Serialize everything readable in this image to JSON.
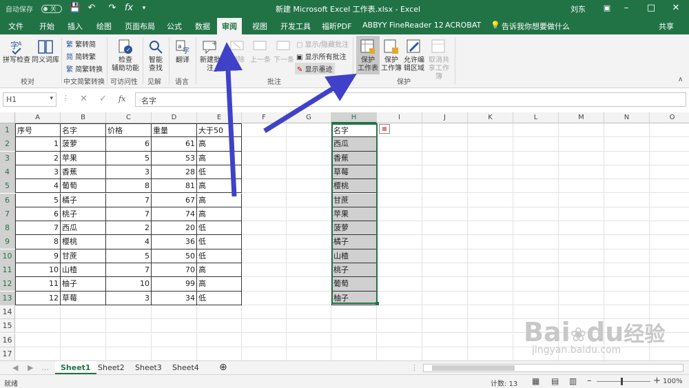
{
  "titlebar": {
    "autosave": "自动保存",
    "autosave_state": "关",
    "title": "新建 Microsoft Excel 工作表.xlsx  -  Excel",
    "user": "刘东"
  },
  "tabs": [
    "文件",
    "开始",
    "插入",
    "绘图",
    "页面布局",
    "公式",
    "数据",
    "审阅",
    "视图",
    "开发工具",
    "福昕PDF",
    "ABBYY FineReader 12",
    "ACROBAT"
  ],
  "tell_me": "告诉我你想要做什么",
  "share": "共享",
  "ribbon": {
    "spell": "拼写检查",
    "thesaurus": "同义词库",
    "group_proof": "校对",
    "trad": "繁转简",
    "simp": "简转繁",
    "convert": "简繁转换",
    "group_chinese": "中文简繁转换",
    "access_check_1": "检查",
    "access_check_2": "辅助功能",
    "group_access": "可访问性",
    "smart_1": "智能",
    "smart_2": "查找",
    "group_insight": "见解",
    "translate": "翻译",
    "group_lang": "语言",
    "new_comment": "新建批注",
    "delete": "删除",
    "prev": "上一条",
    "next": "下一条",
    "show_hide": "显示/隐藏批注",
    "show_all": "显示所有批注",
    "show_ink": "显示墨迹",
    "group_comment": "批注",
    "protect_sheet_1": "保护",
    "protect_sheet_2": "工作表",
    "protect_wb_1": "保护",
    "protect_wb_2": "工作簿",
    "allow_1": "允许编",
    "allow_2": "辑区域",
    "unshare_1": "取消共",
    "unshare_2": "享工作簿",
    "group_protect": "保护"
  },
  "formula_bar": {
    "name_box": "H1",
    "fx": "fx",
    "content": "名字"
  },
  "columns": [
    "A",
    "B",
    "C",
    "D",
    "E",
    "F",
    "G",
    "H",
    "I",
    "J",
    "K",
    "L",
    "M",
    "N",
    "O"
  ],
  "table": {
    "headers": [
      "序号",
      "名字",
      "价格",
      "重量",
      "大于50"
    ],
    "rows": [
      [
        "1",
        "菠萝",
        "6",
        "61",
        "高"
      ],
      [
        "2",
        "苹果",
        "5",
        "53",
        "高"
      ],
      [
        "3",
        "香蕉",
        "3",
        "28",
        "低"
      ],
      [
        "4",
        "葡萄",
        "8",
        "81",
        "高"
      ],
      [
        "5",
        "橘子",
        "7",
        "67",
        "高"
      ],
      [
        "6",
        "桃子",
        "7",
        "74",
        "高"
      ],
      [
        "7",
        "西瓜",
        "2",
        "20",
        "低"
      ],
      [
        "8",
        "樱桃",
        "4",
        "36",
        "低"
      ],
      [
        "9",
        "甘蔗",
        "5",
        "50",
        "低"
      ],
      [
        "10",
        "山楂",
        "7",
        "70",
        "高"
      ],
      [
        "11",
        "柚子",
        "10",
        "99",
        "高"
      ],
      [
        "12",
        "草莓",
        "3",
        "34",
        "低"
      ]
    ]
  },
  "h_list": {
    "header": "名字",
    "items": [
      "西瓜",
      "香蕉",
      "草莓",
      "樱桃",
      "甘蔗",
      "苹果",
      "菠萝",
      "橘子",
      "山楂",
      "桃子",
      "葡萄",
      "柚子"
    ]
  },
  "rows_visible": [
    "1",
    "2",
    "3",
    "4",
    "5",
    "6",
    "7",
    "8",
    "9",
    "10",
    "11",
    "12",
    "13",
    "14",
    "15",
    "16",
    "17"
  ],
  "sheets": [
    "Sheet1",
    "Sheet2",
    "Sheet3",
    "Sheet4"
  ],
  "status": {
    "ready": "就绪",
    "count_label": "计数: 13",
    "zoom": "100%"
  },
  "watermark": {
    "brand": "Bai",
    "du": "du",
    "cn": "经验",
    "url": "jingyan.baidu.com"
  },
  "colors": {
    "excel_green": "#217346",
    "arrow": "#3f42c8"
  }
}
